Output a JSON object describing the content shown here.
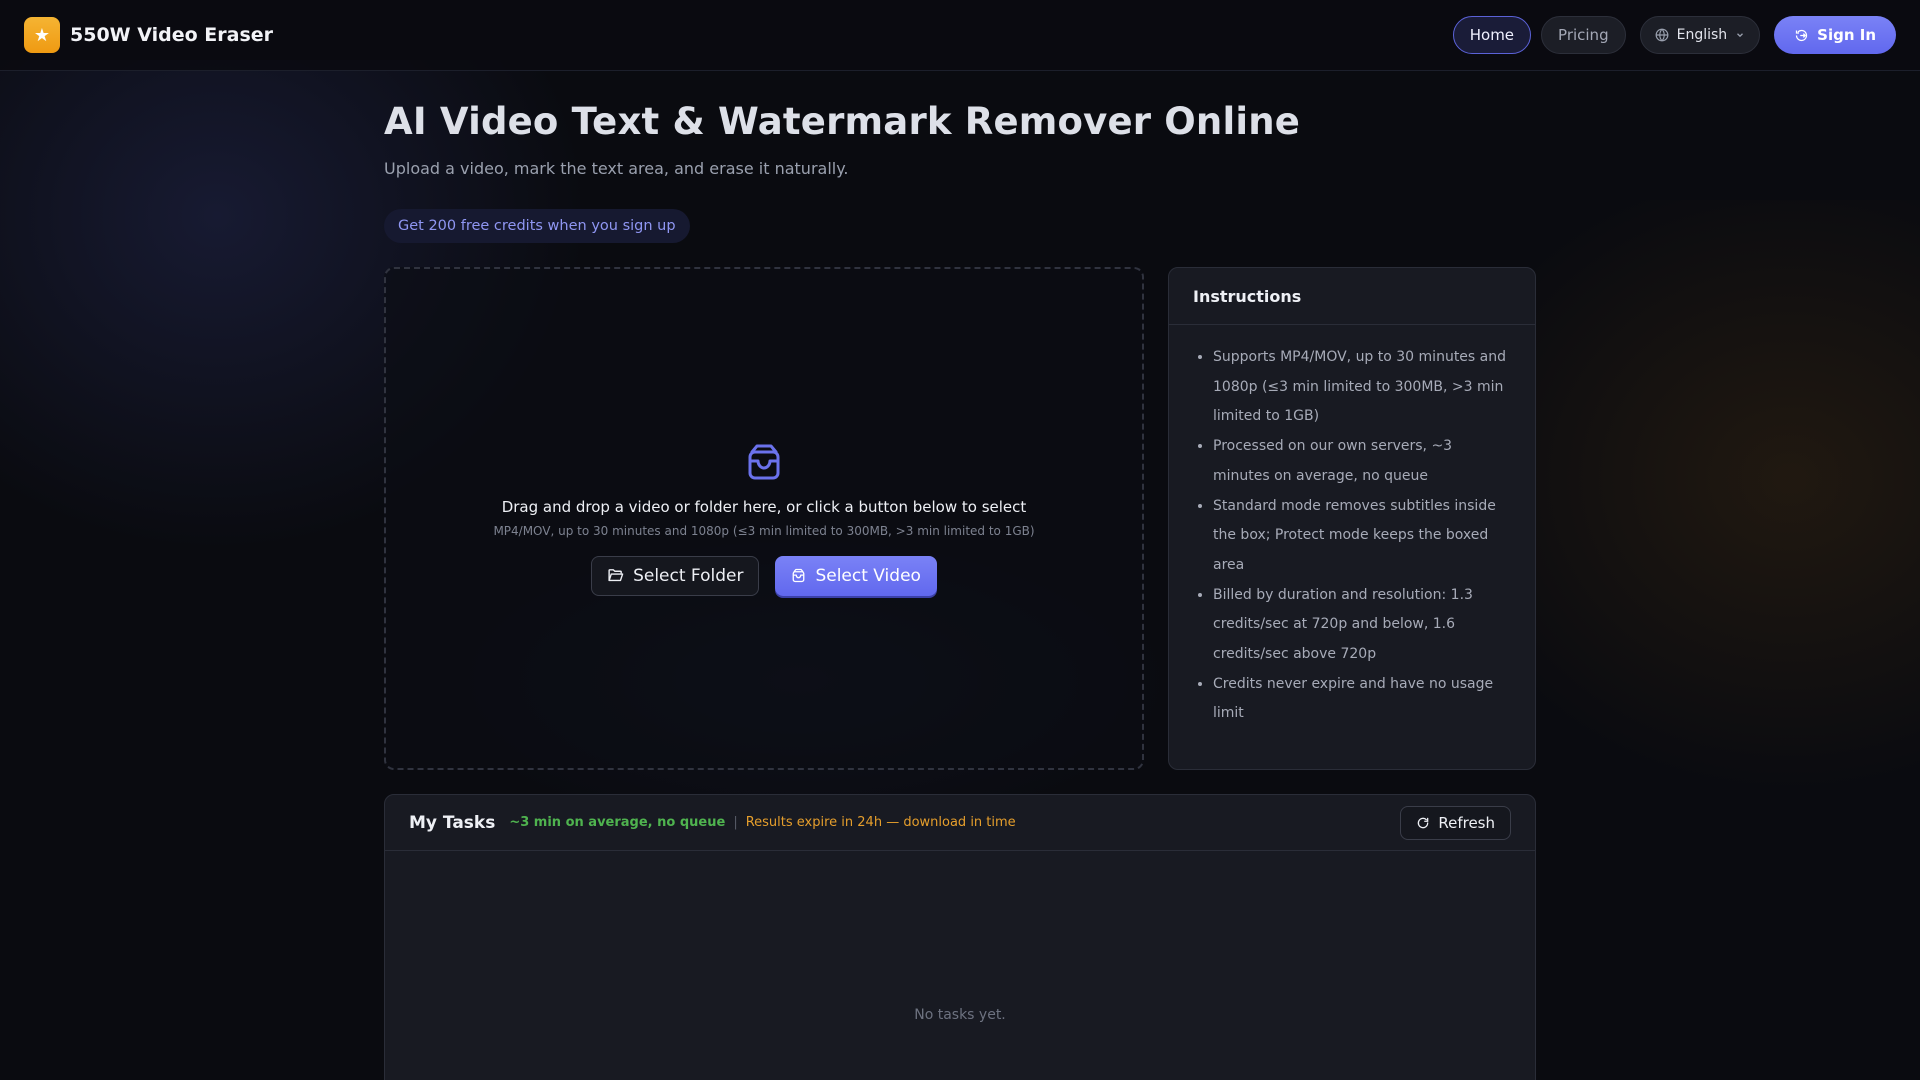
{
  "header": {
    "brand_name": "550W Video Eraser",
    "nav": {
      "home": "Home",
      "pricing": "Pricing"
    },
    "language": "English",
    "sign_in": "Sign In"
  },
  "hero": {
    "title": "AI Video Text & Watermark Remover Online",
    "subtitle": "Upload a video, mark the text area, and erase it naturally.",
    "promo": "Get 200 free credits when you sign up"
  },
  "upload": {
    "main_text": "Drag and drop a video or folder here, or click a button below to select",
    "sub_text": "MP4/MOV, up to 30 minutes and 1080p (≤3 min limited to 300MB, >3 min limited to 1GB)",
    "select_folder": "Select Folder",
    "select_video": "Select Video"
  },
  "instructions": {
    "title": "Instructions",
    "items": [
      "Supports MP4/MOV, up to 30 minutes and 1080p (≤3 min limited to 300MB, >3 min limited to 1GB)",
      "Processed on our own servers, ~3 minutes on average, no queue",
      "Standard mode removes subtitles inside the box; Protect mode keeps the boxed area",
      "Billed by duration and resolution: 1.3 credits/sec at 720p and below, 1.6 credits/sec above 720p",
      "Credits never expire and have no usage limit"
    ]
  },
  "tasks": {
    "title": "My Tasks",
    "eta": "~3 min on average, no queue",
    "separator": "|",
    "expire": "Results expire in 24h — download in time",
    "refresh": "Refresh",
    "empty": "No tasks yet."
  },
  "colors": {
    "accent": "#6c73f2",
    "brand_icon": "#f2a623",
    "eta_green": "#4fb34f",
    "expire_orange": "#e59e2c"
  },
  "icons": {
    "brand": "star-icon",
    "language": "globe-icon",
    "sign_in": "login-icon",
    "dropzone": "inbox-icon",
    "folder": "folder-open-icon",
    "video": "inbox-icon",
    "refresh": "refresh-icon"
  }
}
